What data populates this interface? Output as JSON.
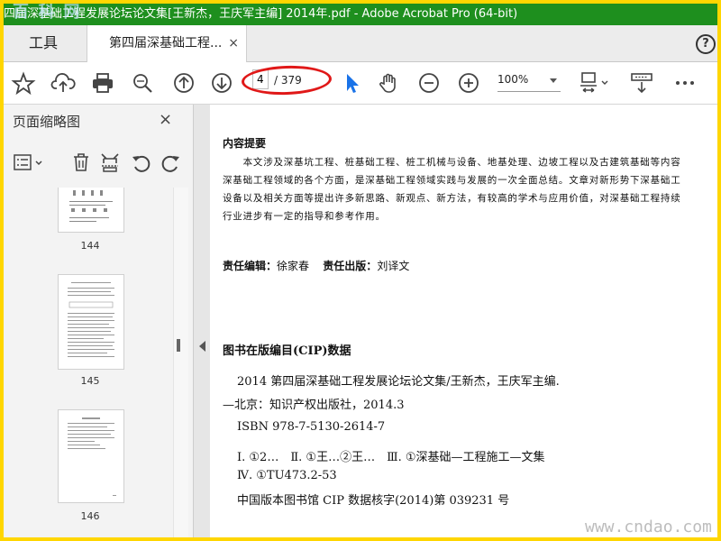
{
  "window": {
    "title": "四届深基础工程发展论坛论文集[王新杰，王庆军主编] 2014年.pdf - Adobe Acrobat Pro (64-bit)",
    "watermark_top": "百 科 网"
  },
  "tabs": {
    "tools_label": "工具",
    "doc_label": "第四届深基础工程...",
    "close_glyph": "×",
    "help_glyph": "?"
  },
  "toolbar": {
    "page_current": "4",
    "page_total": "/ 379",
    "zoom": "100%",
    "icons": [
      "star-icon",
      "cloud-upload-icon",
      "printer-icon",
      "zoom-search-icon",
      "page-up-icon",
      "page-down-icon",
      "select-pointer-icon",
      "hand-tool-icon",
      "zoom-out-icon",
      "zoom-in-icon",
      "fit-page-icon",
      "scroll-mode-icon",
      "more-icon"
    ]
  },
  "panel": {
    "title": "页面缩略图",
    "close_glyph": "×",
    "thumbnails": [
      {
        "page": "144"
      },
      {
        "page": "145"
      },
      {
        "page": "146"
      }
    ]
  },
  "document": {
    "summary_heading": "内容提要",
    "summary_lines": [
      "　　本文涉及深基坑工程、桩基础工程、桩工机械与设备、地基处理、边坡工程以及古建筑基础等内容",
      "深基础工程领域的各个方面，是深基础工程领域实践与发展的一次全面总结。文章对新形势下深基础工",
      "设备以及相关方面等提出许多新思路、新观点、新方法，有较高的学术与应用价值，对深基础工程持续",
      "行业进步有一定的指导和参考作用。"
    ],
    "editor_label": "责任编辑：",
    "editor_name": "徐家春",
    "publisher_label": "责任出版：",
    "publisher_name": "刘译文",
    "cip_heading": "图书在版编目(CIP)数据",
    "cip_lines": [
      "2014 第四届深基础工程发展论坛论文集/王新杰，王庆军主编.",
      "—北京：知识产权出版社，2014.3",
      "ISBN 978-7-5130-2614-7",
      "Ⅰ. ①2…　Ⅱ. ①王…②王…　Ⅲ. ①深基础—工程施工—文集",
      "Ⅳ. ①TU473.2-53",
      "中国版本图书馆 CIP 数据核字(2014)第 039231 号"
    ],
    "watermark_bottom": "www.cndao.com"
  },
  "colors": {
    "titlebar": "#1e8f1e",
    "frame": "#ffd600",
    "highlight_oval": "#e01818",
    "pointer_blue": "#1a73e8"
  }
}
